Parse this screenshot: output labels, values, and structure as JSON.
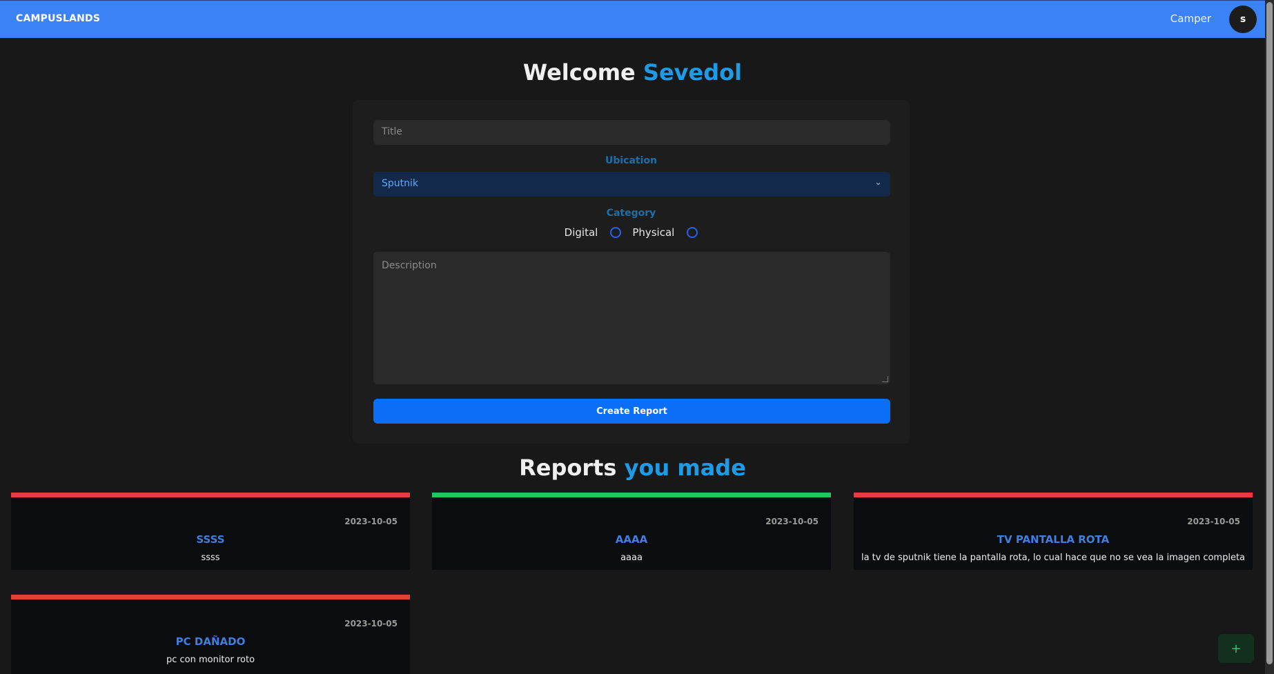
{
  "header": {
    "brand": "CAMPUSLANDS",
    "role": "Camper",
    "avatar_initial": "s"
  },
  "welcome": {
    "prefix": "Welcome",
    "name": "Sevedol"
  },
  "form": {
    "title_placeholder": "Title",
    "ubication_label": "Ubication",
    "ubication_value": "Sputnik",
    "category_label": "Category",
    "category_options": [
      "Digital",
      "Physical"
    ],
    "description_placeholder": "Description",
    "submit_label": "Create Report"
  },
  "reports_heading": {
    "prefix": "Reports",
    "accent": "you made"
  },
  "reports": [
    {
      "date": "2023-10-05",
      "title": "SSSS",
      "description": "ssss",
      "status_color": "#e53e3e"
    },
    {
      "date": "2023-10-05",
      "title": "AAAA",
      "description": "aaaa",
      "status_color": "#22c55e"
    },
    {
      "date": "2023-10-05",
      "title": "TV PANTALLA ROTA",
      "description": "la tv de sputnik tiene la pantalla rota, lo cual hace que no se vea la imagen completa",
      "status_color": "#e53e3e"
    },
    {
      "date": "2023-10-05",
      "title": "PC DAÑADO",
      "description": "pc con monitor roto",
      "status_color": "#e53e3e"
    }
  ],
  "fab_label": "+",
  "colors": {
    "accent": "#1e9be4",
    "topbar": "#3b82f6",
    "primary_button": "#0a6ef7"
  }
}
